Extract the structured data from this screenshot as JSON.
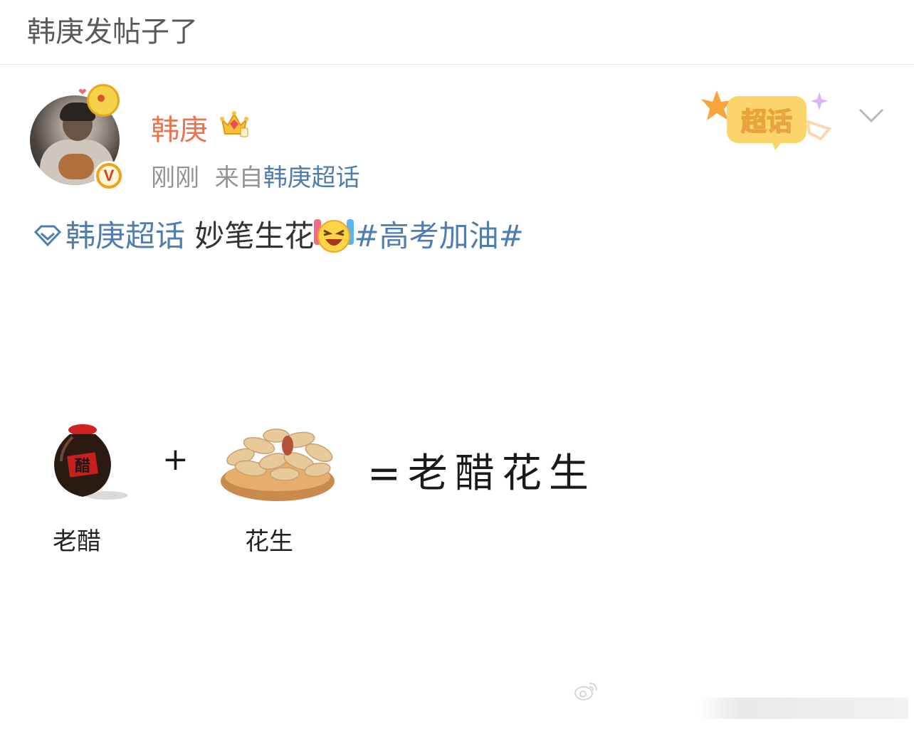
{
  "header": {
    "title": "韩庚发帖子了"
  },
  "post": {
    "username": "韩庚",
    "time": "刚刚",
    "from_prefix": "来自",
    "from_source": "韩庚超话",
    "chaohua_badge": "超话",
    "text": {
      "topic_link": "韩庚超话",
      "body": " 妙笔生花",
      "hashtag": "#高考加油#"
    },
    "image": {
      "plus": "+",
      "equation": "=老醋花生",
      "label_left": "老醋",
      "label_right": "花生",
      "vinegar_jar_text": "醋"
    }
  },
  "icons": {
    "verified": "v-badge-icon",
    "crown": "crown-icon",
    "chevron": "chevron-down-icon",
    "topic": "diamond-icon",
    "emoji": "laughing-emoji-icon",
    "watermark": "weibo-logo-icon"
  },
  "colors": {
    "username": "#eb7350",
    "link": "#507daf",
    "meta": "#939393",
    "badge_bg": "#fbd56b"
  }
}
